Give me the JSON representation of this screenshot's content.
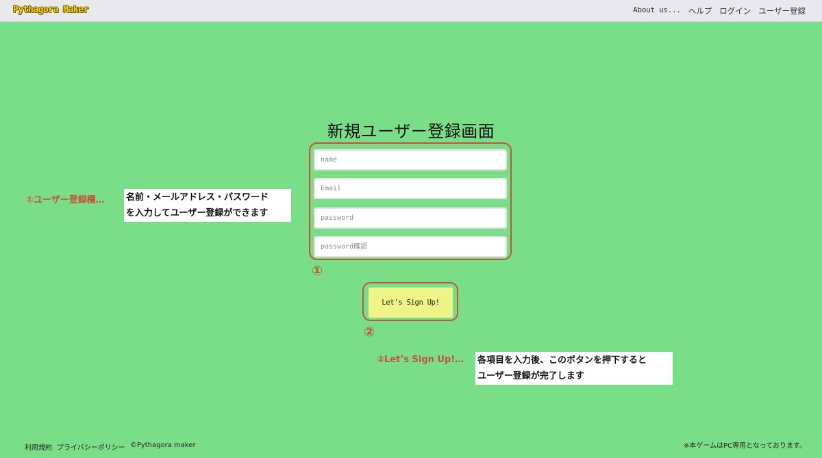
{
  "header": {
    "brand": "Pythagora Maker",
    "nav": {
      "about": "About us...",
      "help": "ヘルプ",
      "login": "ログイン",
      "register": "ユーザー登録"
    }
  },
  "main": {
    "title": "新規ユーザー登録画面",
    "fields": {
      "name_placeholder": "name",
      "email_placeholder": "Email",
      "password_placeholder": "password",
      "password_confirm_placeholder": "password確認"
    },
    "marker_1": "①",
    "marker_2": "②",
    "signup_button": "Let's Sign Up!"
  },
  "annotations": {
    "a1_label": "①ユーザー登録欄…",
    "a1_line1": "名前・メールアドレス・パスワード",
    "a1_line2": "を入力してユーザー登録ができます",
    "a2_label": "②Let’s Sign Up!…",
    "a2_line1": "各項目を入力後、このボタンを押下すると",
    "a2_line2": "ユーザー登録が完了します"
  },
  "footer": {
    "terms": "利用規約",
    "privacy": "プライバシーポリシー",
    "copyright": "©Pythagora maker",
    "notice": "※本ゲームはPC専用となっております。"
  },
  "colors": {
    "background": "#7ade89",
    "highlight": "#c9503a",
    "button": "#eef487",
    "brand": "#f2d21a"
  }
}
